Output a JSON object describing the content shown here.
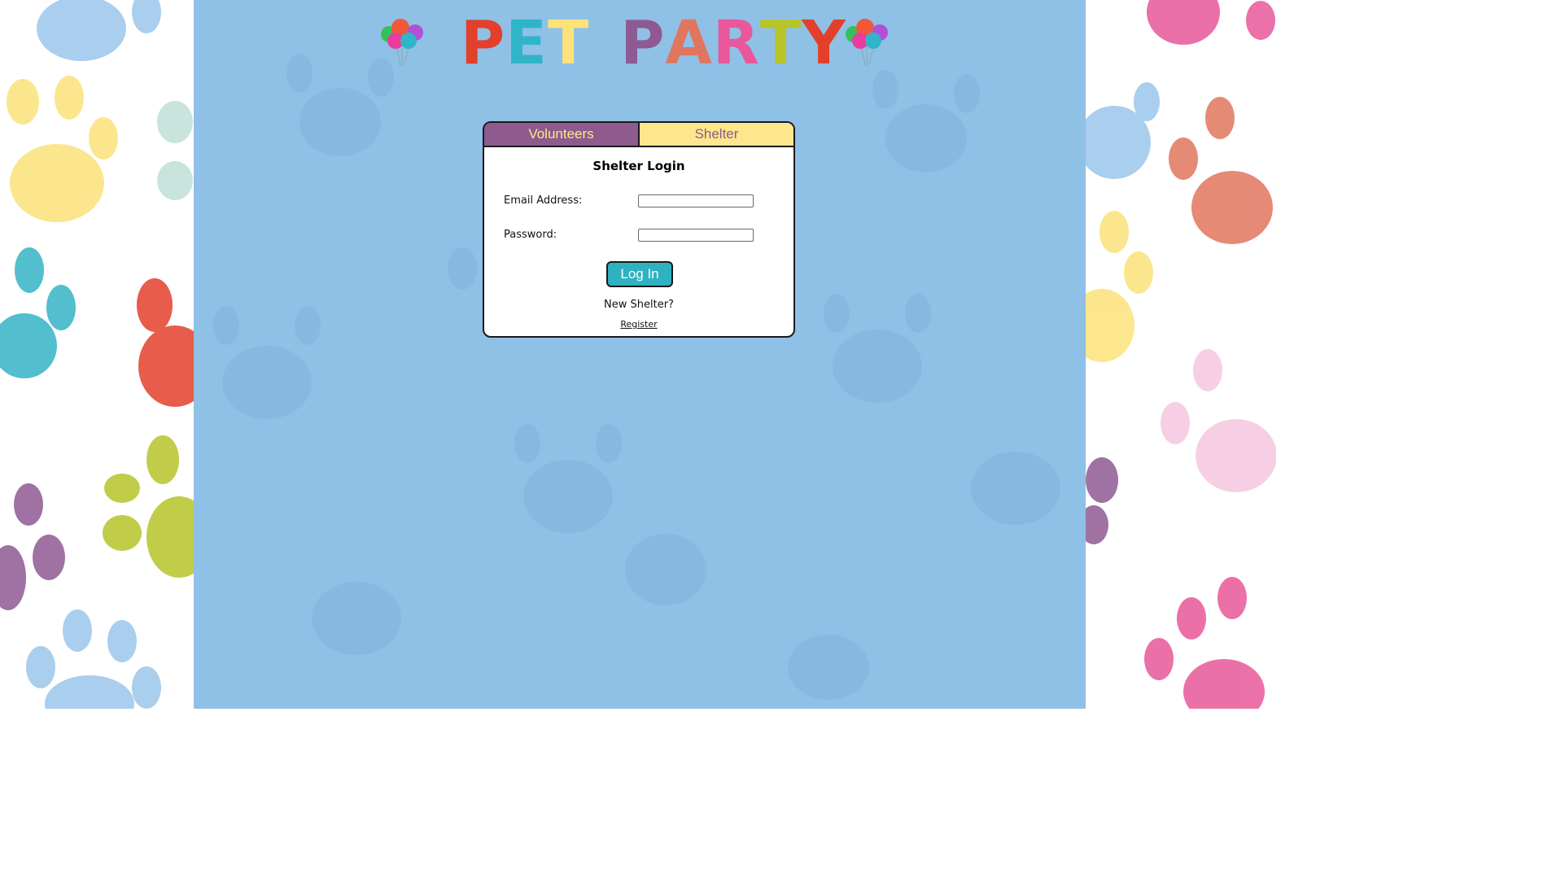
{
  "header": {
    "title_word1": [
      "P",
      "E",
      "T"
    ],
    "title_word2": [
      "P",
      "A",
      "R",
      "T",
      "Y"
    ],
    "title_colors1": [
      "#e3402b",
      "#2fb5c7",
      "#fde27a"
    ],
    "title_colors2": [
      "#8f5a93",
      "#e0765e",
      "#e8589a",
      "#b7c42a",
      "#e3402b"
    ]
  },
  "tabs": {
    "volunteers_label": "Volunteers",
    "shelter_label": "Shelter"
  },
  "login": {
    "title": "Shelter Login",
    "email_label": "Email Address:",
    "email_value": "",
    "password_label": "Password:",
    "password_value": "",
    "button_label": "Log In",
    "new_shelter_text": "New Shelter?",
    "register_label": "Register"
  },
  "colors": {
    "page_background": "#8fc0e6",
    "tab_volunteers": "#8f5a8e",
    "tab_shelter": "#fde68d",
    "button": "#2eb2c2"
  }
}
